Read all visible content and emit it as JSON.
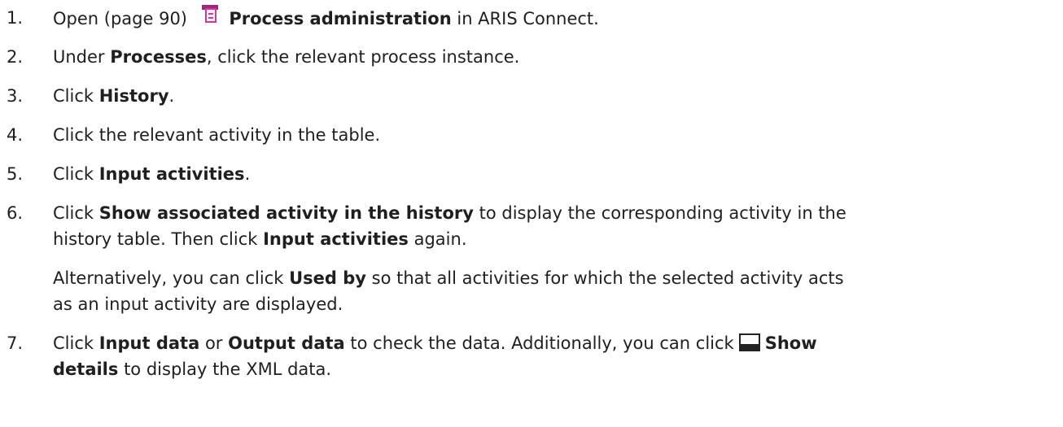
{
  "steps": [
    {
      "number": "1.",
      "parts": {
        "open": "Open (page 90)",
        "bold": "Process administration",
        "rest": "in ARIS Connect."
      },
      "icon": "process-administration-icon"
    },
    {
      "number": "2.",
      "parts": {
        "pre": "Under",
        "bold": "Processes",
        "rest": ", click the relevant process instance."
      }
    },
    {
      "number": "3.",
      "parts": {
        "pre": "Click",
        "bold": "History",
        "rest": "."
      }
    },
    {
      "number": "4.",
      "parts": {
        "text": "Click the relevant activity in the table."
      }
    },
    {
      "number": "5.",
      "parts": {
        "pre": "Click",
        "bold": "Input activities",
        "rest": "."
      }
    },
    {
      "number": "6.",
      "parts": {
        "pre": "Click",
        "bold": "Show associated activity in the history",
        "rest": "to display the corresponding activity in the",
        "line2_pre": "history table. Then click",
        "line2_bold": "Input activities",
        "line2_rest": "again."
      },
      "note": {
        "pre": "Alternatively, you can click",
        "bold": "Used by",
        "rest": "so that all activities for which the selected activity acts",
        "line2": "as an input activity are displayed."
      }
    },
    {
      "number": "7.",
      "parts": {
        "pre": "Click",
        "bold1": "Input data",
        "mid": "or",
        "bold2": "Output data",
        "rest": "to check the data. Additionally, you can click",
        "bold3": "Show",
        "line2_bold": "details",
        "line2_rest": "to display the XML data."
      },
      "icon": "show-details-icon"
    }
  ]
}
